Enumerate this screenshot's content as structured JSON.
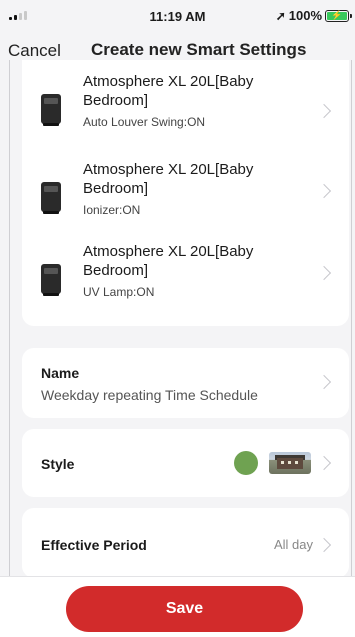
{
  "status_bar": {
    "time": "11:19 AM",
    "battery": "100%"
  },
  "nav": {
    "cancel_label": "Cancel",
    "title": "Create new Smart Settings"
  },
  "devices": [
    {
      "name": "Atmosphere XL 20L[Baby Bedroom]",
      "action": "Auto Louver Swing:ON",
      "icon": "air-purifier-icon"
    },
    {
      "name": "Atmosphere XL 20L[Baby Bedroom]",
      "action": "Ionizer:ON",
      "icon": "air-purifier-icon"
    },
    {
      "name": "Atmosphere XL 20L[Baby Bedroom]",
      "action": "UV Lamp:ON",
      "icon": "air-purifier-icon"
    }
  ],
  "name_row": {
    "label": "Name",
    "value": "Weekday repeating Time Schedule"
  },
  "style_row": {
    "label": "Style",
    "color": "#6fa251"
  },
  "period_row": {
    "label": "Effective Period",
    "value": "All day"
  },
  "footer": {
    "save_label": "Save",
    "accent": "#d22b2b"
  }
}
